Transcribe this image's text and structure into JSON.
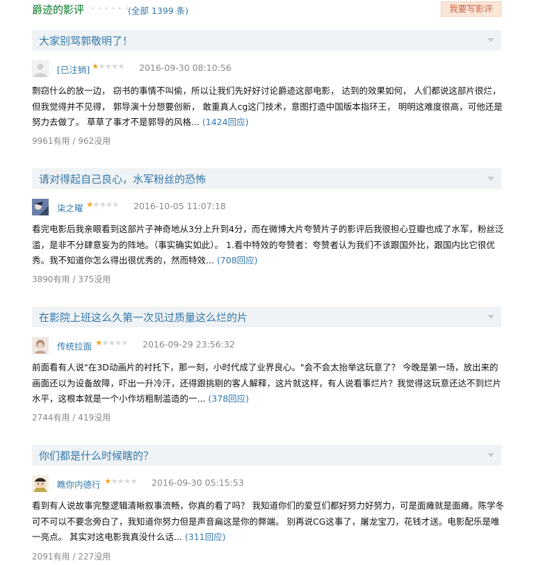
{
  "section": {
    "title": "爵迹的影评",
    "dots": "· · · · · ·",
    "total": "(全部 1399 条)",
    "write_review": "我要写影评"
  },
  "colors": {
    "link": "#3377aa",
    "section_title": "#007722",
    "header_bg": "#f0f3f5",
    "star": "#f5a623",
    "button_bg": "#fae6d9",
    "button_text": "#ca6445"
  },
  "reviews": [
    {
      "title": "大家别骂郭敬明了！",
      "author": "[已注销]",
      "rating": 1,
      "date": "2016-09-30 08:10:56",
      "text": "剽窃什么的放一边， 窃书的事情不叫偷，所以让我们先好好讨论爵迹这部电影， 达到的效果如何， 人们都说这部片很烂，但我觉得并不见得， 郭导演十分想要创新， 敢重真人cg这门技术，意图打造中国版本指环王， 明明这难度很高，可他还是努力去做了。 草草了事才不是郭导的风格...",
      "replies": "(1424回应)",
      "votes": "9961有用 / 962没用",
      "avatar_icon": "default-user-icon"
    },
    {
      "title": "请对得起自己良心，水军粉丝的恐怖",
      "author": "柒之曜",
      "rating": 1,
      "date": "2016-10-05 11:07:18",
      "text": "看完电影后我亲眼看到这部片子神奇地从3分上升到4分，而在微博大片夸赞片子的影评后我很担心豆瓣也成了水军，粉丝泛滥，是非不分肆意妄为的阵地。（事实确实如此）。 1.看中特效的夸赞者：夸赞者认为我们不该跟国外比，跟国内比它很优秀。我不知道你怎么得出很优秀的，然而特效...",
      "replies": "(708回应)",
      "votes": "3890有用 / 375没用",
      "avatar_icon": "anime-avatar-icon"
    },
    {
      "title": "在影院上班这么久第一次见过质量这么烂的片",
      "author": "传统拉面",
      "rating": 1,
      "date": "2016-09-29 23:56:32",
      "text": "前面看有人说\"在3D动画片的衬托下，那一刻，小时代成了业界良心。\"会不会太抬举这玩意了？ 今晚是第一场，放出来的画面还以为设备故障，吓出一升冷汗，还得跟挑剔的客人解释，这片就这样，有人说看事烂片？我觉得这玩意还达不到烂片水平，这根本就是一个小作坊粗制滥造的一...",
      "replies": "(378回应)",
      "votes": "2744有用 / 419没用",
      "avatar_icon": "portrait-avatar-icon"
    },
    {
      "title": "你们都是什么时候瞎的？",
      "author": "瞧你内德行",
      "rating": 1,
      "date": "2016-09-30 05:15:53",
      "text": "看到有人说故事完整逻辑清晰叙事流畅，你真的看了吗？ 我知道你们的爱豆们都好努力好努力，可是面瘫就是面瘫。陈学冬可不可以不要念旁白了，我知道你努力但是声音扁这是你的弊端。 别再说CG这事了，屠龙宝刀，花钱才送。电影配乐是唯一亮点。 其实对这电影我真没什么话...",
      "replies": "(311回应)",
      "votes": "2091有用 / 227没用",
      "avatar_icon": "baby-avatar-icon"
    }
  ]
}
